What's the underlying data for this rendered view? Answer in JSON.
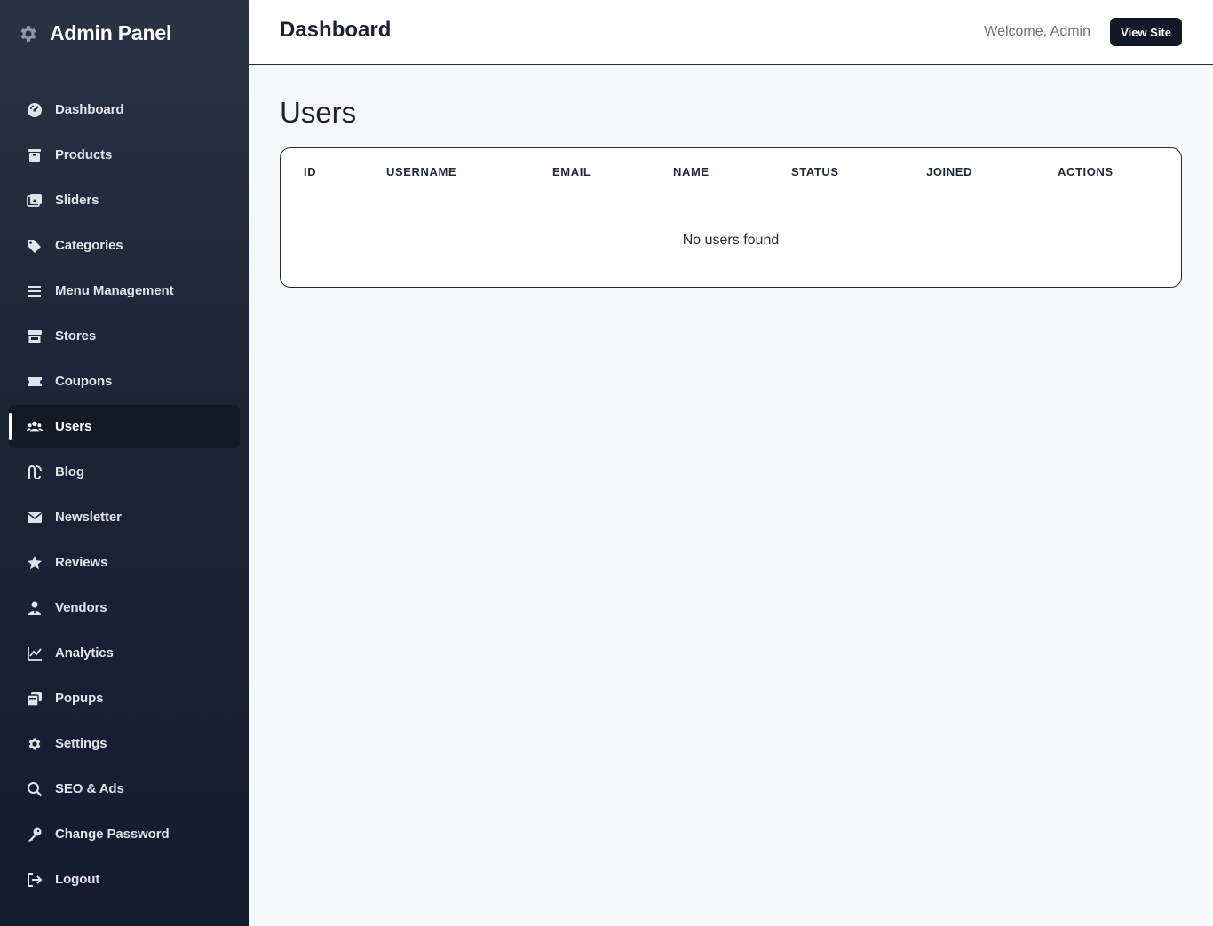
{
  "sidebar": {
    "brand": "Admin Panel",
    "items": [
      {
        "label": "Dashboard",
        "icon": "dashboard-icon"
      },
      {
        "label": "Products",
        "icon": "box-icon"
      },
      {
        "label": "Sliders",
        "icon": "images-icon"
      },
      {
        "label": "Categories",
        "icon": "tags-icon"
      },
      {
        "label": "Menu Management",
        "icon": "bars-icon"
      },
      {
        "label": "Stores",
        "icon": "store-icon"
      },
      {
        "label": "Coupons",
        "icon": "ticket-icon"
      },
      {
        "label": "Users",
        "icon": "users-icon",
        "active": true
      },
      {
        "label": "Blog",
        "icon": "blog-icon"
      },
      {
        "label": "Newsletter",
        "icon": "envelope-icon"
      },
      {
        "label": "Reviews",
        "icon": "star-icon"
      },
      {
        "label": "Vendors",
        "icon": "user-tie-icon"
      },
      {
        "label": "Analytics",
        "icon": "chart-line-icon"
      },
      {
        "label": "Popups",
        "icon": "window-icon"
      },
      {
        "label": "Settings",
        "icon": "gear-icon"
      },
      {
        "label": "SEO & Ads",
        "icon": "search-icon"
      },
      {
        "label": "Change Password",
        "icon": "key-icon"
      },
      {
        "label": "Logout",
        "icon": "logout-icon"
      }
    ]
  },
  "header": {
    "title": "Dashboard",
    "welcome": "Welcome, Admin",
    "view_site": "View Site"
  },
  "main": {
    "title": "Users",
    "table": {
      "columns": [
        "ID",
        "USERNAME",
        "EMAIL",
        "NAME",
        "STATUS",
        "JOINED",
        "ACTIONS"
      ],
      "empty_message": "No users found"
    }
  },
  "colors": {
    "sidebar_top": "#2a3344",
    "sidebar_bottom": "#131b2e",
    "active_bg": "#131a26",
    "button_bg": "#111827",
    "page_bg": "#f7f8fa"
  }
}
